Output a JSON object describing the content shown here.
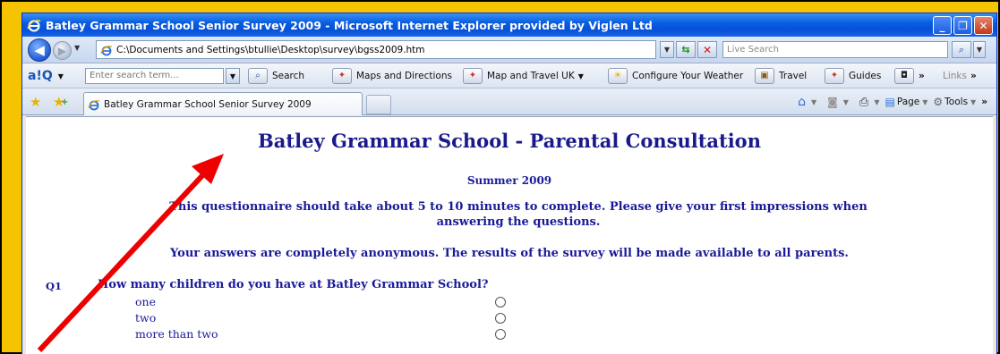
{
  "window": {
    "title": "Batley Grammar School Senior Survey 2009 - Microsoft Internet Explorer provided by Viglen Ltd",
    "minimize": "_",
    "maximize": "❐",
    "close": "✕"
  },
  "address_bar": {
    "url": "C:\\Documents and Settings\\btullie\\Desktop\\survey\\bgss2009.htm",
    "search_placeholder": "Live Search"
  },
  "toolbar": {
    "search_placeholder": "Enter search term...",
    "search_label": "Search",
    "maps_label": "Maps and Directions",
    "map_travel_label": "Map and Travel UK",
    "weather_label": "Configure Your Weather",
    "travel_label": "Travel",
    "guides_label": "Guides",
    "links_label": "Links",
    "more": "»"
  },
  "tabs": {
    "active_label": "Batley Grammar School Senior Survey 2009",
    "page_label": "Page",
    "tools_label": "Tools"
  },
  "page": {
    "heading": "Batley Grammar School - Parental Consultation",
    "subheading": "Summer 2009",
    "intro_line1": "This questionnaire should take about 5 to 10 minutes to complete.  Please give your first impressions when",
    "intro_line2": "answering the questions.",
    "anonymity": "Your answers are completely anonymous.  The results of the survey will be made available to all parents.",
    "question": {
      "number": "Q1",
      "text": "How many children do you have at Batley Grammar School?",
      "options": [
        "one",
        "two",
        "more than two"
      ]
    }
  },
  "colors": {
    "frame": "#f5c400",
    "heading": "#1a1a8c",
    "arrow": "#ee0000"
  }
}
